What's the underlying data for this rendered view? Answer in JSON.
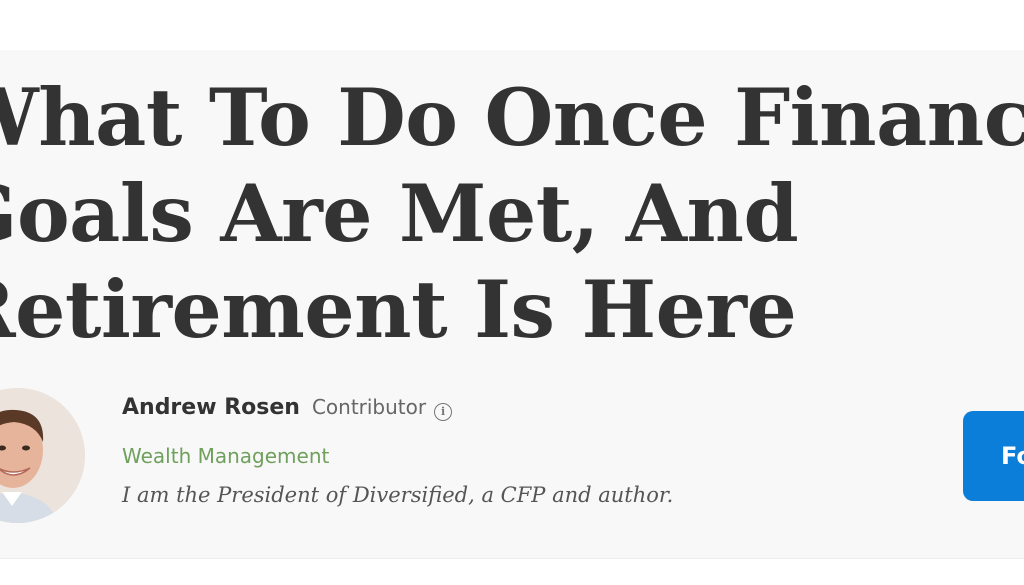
{
  "article": {
    "headline_lines": [
      "What To Do Once Financial",
      "Goals Are Met, And",
      "Retirement Is Here"
    ]
  },
  "author": {
    "name": "Andrew Rosen",
    "role": "Contributor",
    "info_icon": "info-icon",
    "channel": "Wealth Management",
    "bio": "I am the President of Diversified, a CFP and author.",
    "avatar_icon": "author-photo"
  },
  "follow_button": {
    "label": "Follow"
  },
  "colors": {
    "background": "#f8f8f8",
    "headline": "#333333",
    "channel": "#6fa05c",
    "follow_button": "#0a7ed8"
  }
}
